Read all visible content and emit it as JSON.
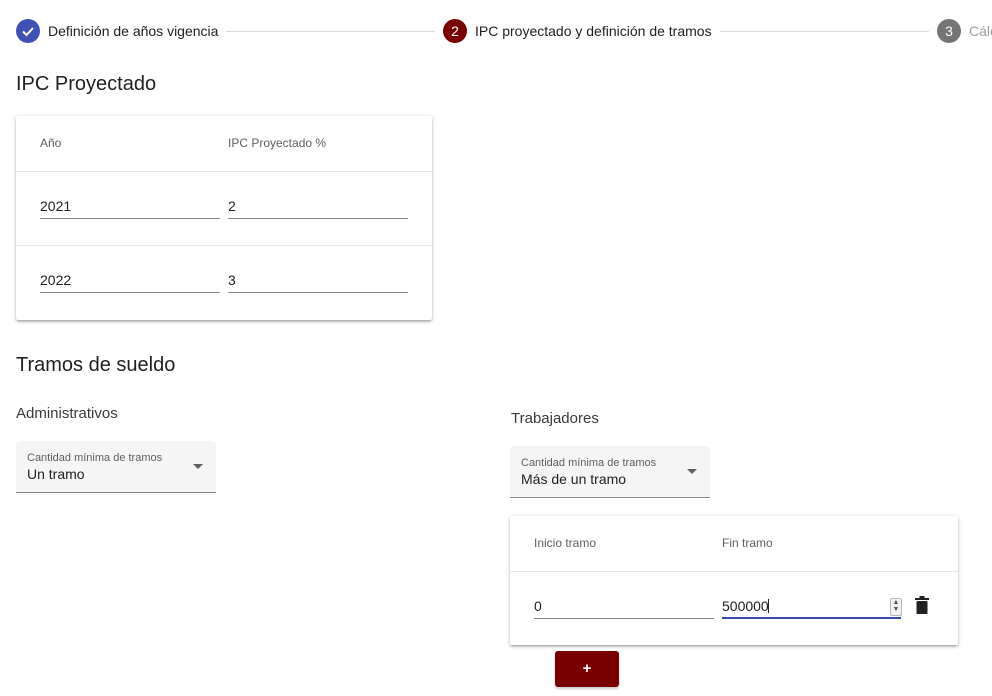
{
  "stepper": {
    "steps": [
      {
        "index": "",
        "label": "Definición de años vigencia",
        "state": "done"
      },
      {
        "index": "2",
        "label": "IPC proyectado y definición de tramos",
        "state": "active"
      },
      {
        "index": "3",
        "label": "Cálc",
        "state": "pending"
      }
    ],
    "colors": {
      "done": "#3f51b5",
      "active": "#7a0000",
      "pending": "#757575"
    }
  },
  "ipc": {
    "title": "IPC Proyectado",
    "headers": {
      "year": "Año",
      "ipc": "IPC Proyectado %"
    },
    "rows": [
      {
        "year": "2021",
        "ipc": "2"
      },
      {
        "year": "2022",
        "ipc": "3"
      }
    ]
  },
  "tramos": {
    "title": "Tramos de sueldo",
    "administrativos": {
      "title": "Administrativos",
      "select_label": "Cantidad mínima de tramos",
      "select_value": "Un tramo"
    },
    "trabajadores": {
      "title": "Trabajadores",
      "select_label": "Cantidad mínima de tramos",
      "select_value": "Más de un tramo",
      "headers": {
        "inicio": "Inicio tramo",
        "fin": "Fin tramo"
      },
      "rows": [
        {
          "inicio": "0",
          "fin": "500000"
        }
      ],
      "add_label": "+"
    }
  }
}
